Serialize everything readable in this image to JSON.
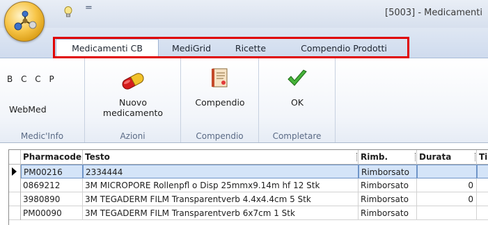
{
  "window": {
    "title": "[5003] - Medicamenti",
    "qat_separator": "="
  },
  "tabs": [
    {
      "label": "Medicamenti CB",
      "active": true
    },
    {
      "label": "MediGrid",
      "active": false
    },
    {
      "label": "Ricette",
      "active": false
    },
    {
      "label": "Compendio Prodotti",
      "active": false
    }
  ],
  "ribbon": {
    "medicinfo": {
      "letters": [
        "B",
        "C",
        "C",
        "P"
      ],
      "webmed": "WebMed",
      "group_label": "Medic'Info"
    },
    "azioni": {
      "button_line1": "Nuovo",
      "button_line2": "medicamento",
      "icon": "pill-icon",
      "group_label": "Azioni"
    },
    "compendio": {
      "button": "Compendio",
      "icon": "book-icon",
      "group_label": "Compendio"
    },
    "completare": {
      "button": "OK",
      "icon": "checkmark-icon",
      "group_label": "Completare"
    }
  },
  "grid": {
    "columns": [
      "Pharmacode",
      "Testo",
      "Rimb.",
      "Durata",
      "Ti"
    ],
    "rows": [
      {
        "pharmacode": "PM00216",
        "testo": "2334444",
        "rimb": "Rimborsato",
        "durata": "",
        "tipo": "",
        "selected": true
      },
      {
        "pharmacode": "0869212",
        "testo": "3M MICROPORE Rollenpfl o Disp 25mmx9.14m hf 12 Stk",
        "rimb": "Rimborsato",
        "durata": "0",
        "tipo": "",
        "selected": false
      },
      {
        "pharmacode": "3980890",
        "testo": "3M TEGADERM FILM Transparentverb 4.4x4.4cm 5 Stk",
        "rimb": "Rimborsato",
        "durata": "0",
        "tipo": "",
        "selected": false
      },
      {
        "pharmacode": "PM00090",
        "testo": "3M TEGADERM FILM Transparentverb 6x7cm 1 Stk",
        "rimb": "Rimborsato",
        "durata": "",
        "tipo": "",
        "selected": false
      }
    ]
  },
  "colors": {
    "highlight_box": "#e00000",
    "selected_row": "#c7dbf5",
    "ribbon_label": "#5a6a85"
  }
}
